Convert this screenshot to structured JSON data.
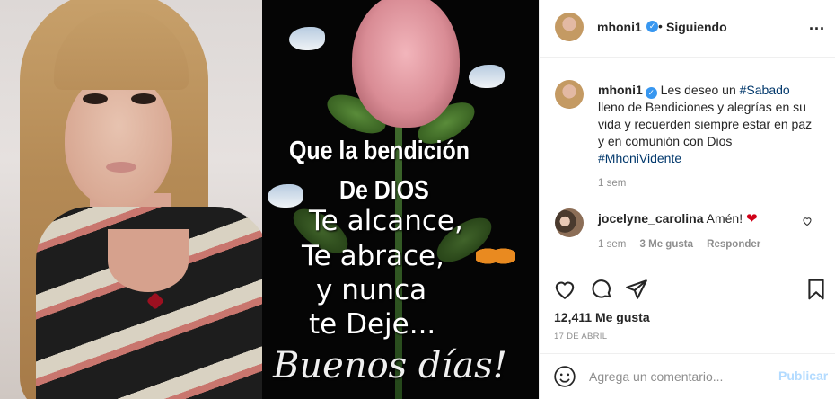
{
  "post_image": {
    "quote_lines": [
      "Que la bendición",
      "De DIOS",
      "Te alcance,",
      "Te abrace,",
      "y nunca",
      "te Deje...",
      "Buenos días!"
    ]
  },
  "header": {
    "username": "mhoni1",
    "separator": "•",
    "follow_status": "Siguiendo",
    "more_label": "..."
  },
  "caption": {
    "username": "mhoni1",
    "text_before": "Les deseo un ",
    "hashtag1": "#Sabado",
    "text_middle": " lleno de Bendiciones y alegrías en su vida y recuerden siempre estar en paz y en comunión con Dios ",
    "hashtag2": "#MhoniVidente",
    "time": "1 sem"
  },
  "comment": {
    "username": "jocelyne_carolina",
    "text": "Amén!",
    "emoji": "❤",
    "time": "1 sem",
    "likes": "3 Me gusta",
    "reply": "Responder"
  },
  "actions": {
    "likes_count": "12,411 Me gusta",
    "date": "17 DE ABRIL"
  },
  "add_comment": {
    "placeholder": "Agrega un comentario...",
    "post_label": "Publicar"
  },
  "colors": {
    "verified": "#3897f0",
    "hashtag": "#00376b",
    "muted": "#8e8e8e",
    "post_button_disabled": "#b3dbff"
  }
}
